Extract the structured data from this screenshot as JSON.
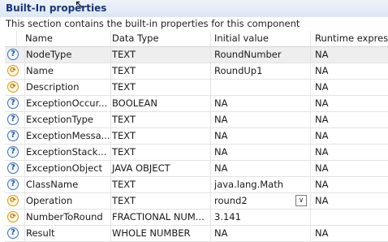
{
  "header": {
    "title": "Built-In properties",
    "description": "This section contains the built-in properties for this component"
  },
  "columns": {
    "name": "Name",
    "type": "Data Type",
    "initial": "Initial value",
    "runtime": "Runtime expressi"
  },
  "rows": [
    {
      "icon": "help-icon",
      "name": "NodeType",
      "type": "TEXT",
      "initial": "RoundNumber",
      "runtime": "NA"
    },
    {
      "icon": "warning-icon",
      "name": "Name",
      "type": "TEXT",
      "initial": "RoundUp1",
      "runtime": "NA"
    },
    {
      "icon": "warning-icon",
      "name": "Description",
      "type": "TEXT",
      "initial": "",
      "runtime": "NA"
    },
    {
      "icon": "help-icon",
      "name": "ExceptionOccur...",
      "type": "BOOLEAN",
      "initial": "NA",
      "runtime": "NA"
    },
    {
      "icon": "help-icon",
      "name": "ExceptionType",
      "type": "TEXT",
      "initial": "NA",
      "runtime": "NA"
    },
    {
      "icon": "help-icon",
      "name": "ExceptionMessa...",
      "type": "TEXT",
      "initial": "NA",
      "runtime": "NA"
    },
    {
      "icon": "help-icon",
      "name": "ExceptionStack...",
      "type": "TEXT",
      "initial": "NA",
      "runtime": "NA"
    },
    {
      "icon": "help-icon",
      "name": "ExceptionObject",
      "type": "JAVA OBJECT",
      "initial": "NA",
      "runtime": "NA"
    },
    {
      "icon": "help-icon",
      "name": "ClassName",
      "type": "TEXT",
      "initial": "java.lang.Math",
      "runtime": "NA"
    },
    {
      "icon": "warning-icon",
      "name": "Operation",
      "type": "TEXT",
      "initial": "round2",
      "runtime": "NA"
    },
    {
      "icon": "warning-icon",
      "name": "NumberToRound",
      "type": "FRACTIONAL NUM...",
      "initial": "3.141",
      "runtime": ""
    },
    {
      "icon": "help-icon",
      "name": "Result",
      "type": "WHOLE NUMBER",
      "initial": "NA",
      "runtime": "NA"
    }
  ]
}
